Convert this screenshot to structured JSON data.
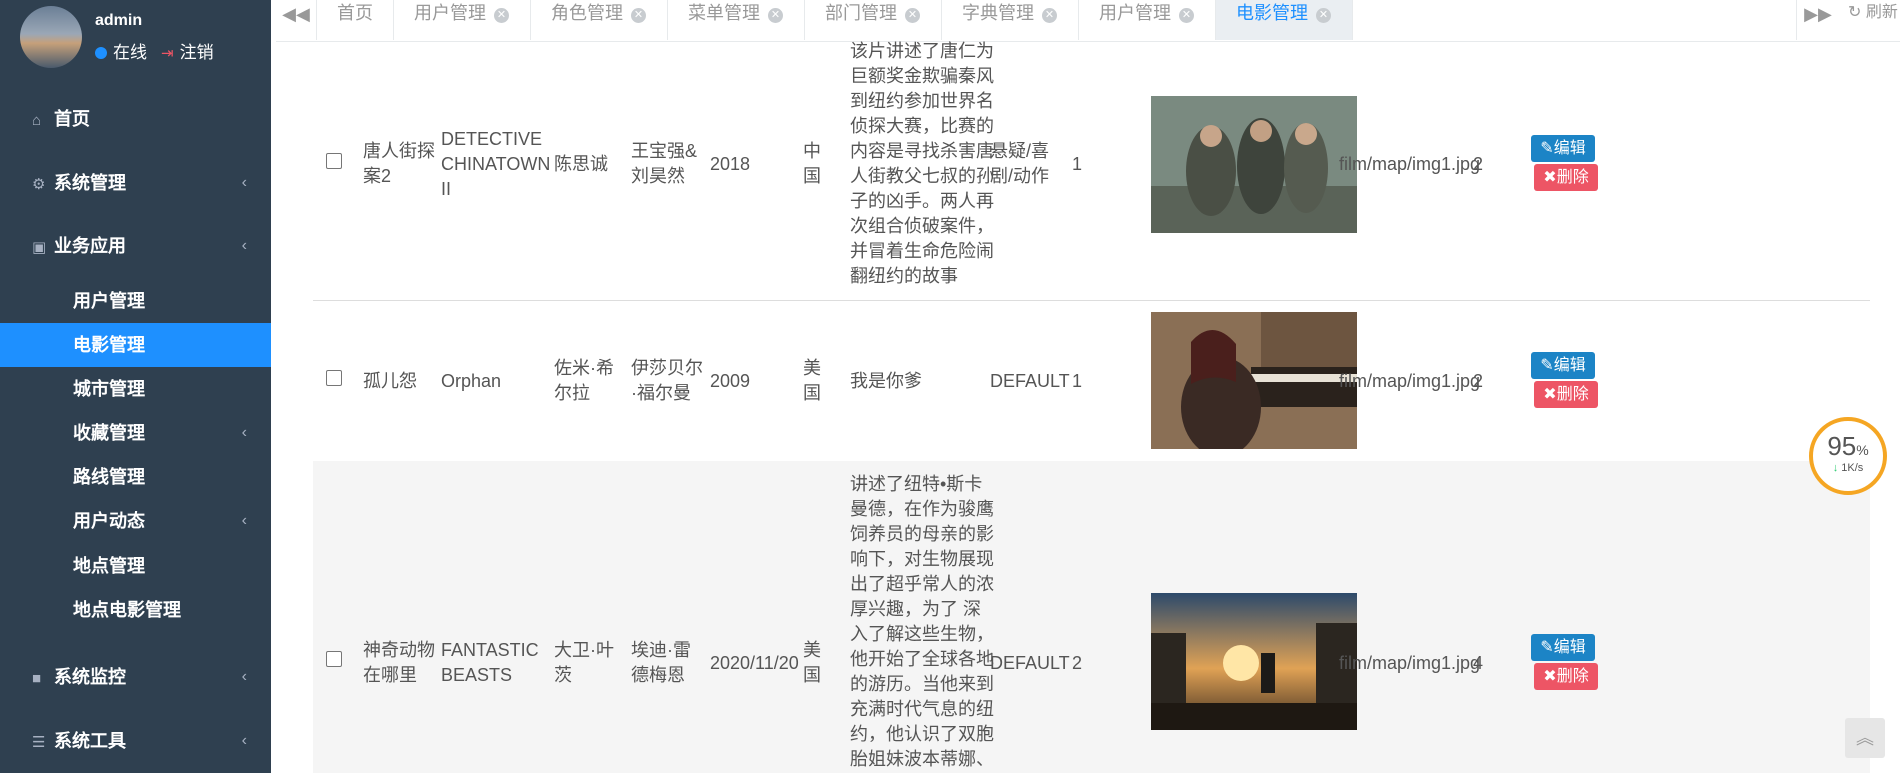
{
  "user": {
    "name": "admin",
    "status": "在线",
    "logout": "注销"
  },
  "menu": {
    "home": "首页",
    "system": "系统管理",
    "business": "业务应用",
    "sub": [
      "用户管理",
      "电影管理",
      "城市管理",
      "收藏管理",
      "路线管理",
      "用户动态",
      "地点管理",
      "地点电影管理"
    ],
    "monitor": "系统监控",
    "tools": "系统工具"
  },
  "tabs": [
    "首页",
    "用户管理",
    "角色管理",
    "菜单管理",
    "部门管理",
    "字典管理",
    "用户管理",
    "电影管理"
  ],
  "refresh": "刷新",
  "rows": [
    {
      "title": "唐人街探案2",
      "en": "DETECTIVE CHINATOWN II",
      "director": "陈思诚",
      "actors": "王宝强&刘昊然",
      "date": "2018",
      "region": "中国",
      "desc": "该片讲述了唐仁为巨额奖金欺骗秦风到纽约参加世界名侦探大赛，比赛的内容是寻找杀害唐人街教父七叔的孙子的凶手。两人再次组合侦破案件，并冒着生命危险闹翻纽约的故事",
      "genre": "悬疑/喜剧/动作",
      "n1": "1",
      "path": "film/map/img1.jpg",
      "n2": "2"
    },
    {
      "title": "孤儿怨",
      "en": "Orphan",
      "director": "佐米·希尔拉",
      "actors": "伊莎贝尔·福尔曼",
      "date": "2009",
      "region": "美国",
      "desc": "我是你爹",
      "genre": "DEFAULT",
      "n1": "1",
      "path": "film/map/img1.jpg",
      "n2": "2"
    },
    {
      "title": "神奇动物在哪里",
      "en": "FANTASTIC BEASTS",
      "director": "大卫·叶茨",
      "actors": "埃迪·雷德梅恩",
      "date": "2020/11/20",
      "region": "美国",
      "desc": "讲述了纽特•斯卡曼德，在作为骏鹰饲养员的母亲的影响下，对生物展现出了超乎常人的浓厚兴趣，为了 深入了解这些生物，他开始了全球各地的游历。当他来到充满时代气息的纽约，他认识了双胞胎姐妹波本蒂娜、",
      "genre": "DEFAULT",
      "n1": "2",
      "path": "film/map/img1.jpg",
      "n2": "4"
    }
  ],
  "buttons": {
    "edit": "编辑",
    "delete": "删除"
  },
  "speed": {
    "percent": "95",
    "unit": "%",
    "rate": "1K/s"
  },
  "colors": {
    "sidebar": "#2f4050",
    "accent": "#1e90ff",
    "edit": "#1c84c6",
    "delete": "#ed5565"
  }
}
